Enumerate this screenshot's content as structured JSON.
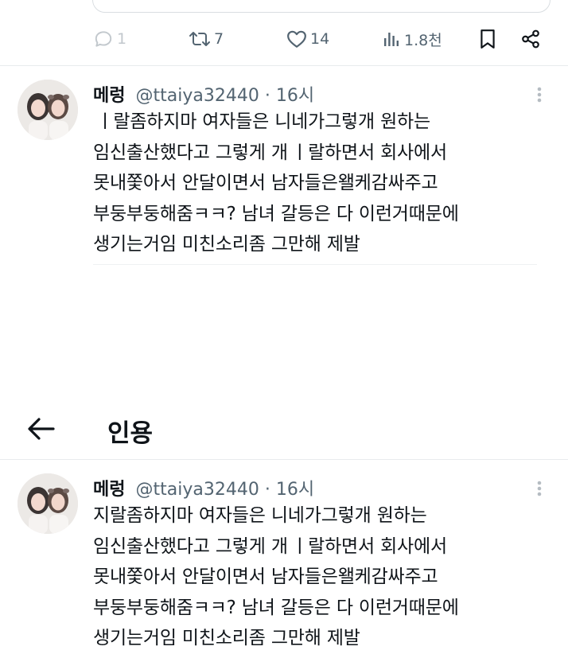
{
  "top_actions": {
    "reply_count": "1",
    "retweet_count": "7",
    "like_count": "14",
    "view_count": "1.8천",
    "icons": [
      "reply-icon",
      "retweet-icon",
      "like-icon",
      "views-icon",
      "bookmark-icon",
      "share-icon"
    ]
  },
  "post1": {
    "author_name": "메렁",
    "handle": "@ttaiya32440",
    "separator": "·",
    "time": "16시",
    "text": " ㅣ랄좀하지마 여자들은 니네가그렇개 원하는\n임신출산했다고 그렇게 개 ㅣ랄하면서 회사에서\n못내쫓아서 안달이면서 남자들은왤케감싸주고\n부둥부둥해줌ㅋㅋ? 남녀 갈등은 다 이런거때문에\n생기는거임 미친소리좀 그만해 제발"
  },
  "quote_header": {
    "title": "인용"
  },
  "post2": {
    "author_name": "메렁",
    "handle": "@ttaiya32440",
    "separator": "·",
    "time": "16시",
    "text": "지랄좀하지마 여자들은 니네가그렇개 원하는\n임신출산했다고 그렇게 개 ㅣ랄하면서 회사에서\n못내쫓아서 안달이면서 남자들은왤케감싸주고\n부둥부둥해줌ㅋㅋ? 남녀 갈등은 다 이런거때문에\n생기는거임 미친소리좀 그만해 제발"
  },
  "colors": {
    "text_primary": "#0f1419",
    "text_secondary": "#536471",
    "divider": "#e8ebed"
  }
}
